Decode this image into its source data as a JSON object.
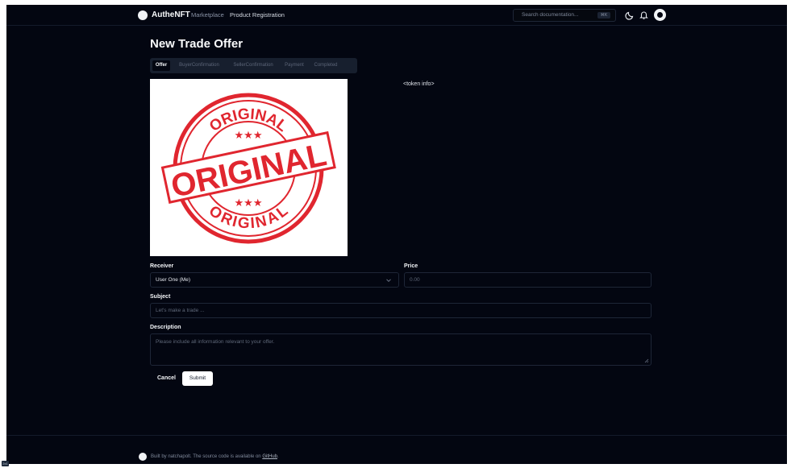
{
  "header": {
    "brand": "AutheNFT",
    "nav": [
      "Marketplace",
      "Product Registration"
    ],
    "search_placeholder": "Search documentation...",
    "search_shortcut": "⌘K",
    "icons": [
      "moon-icon",
      "bell-icon",
      "avatar"
    ]
  },
  "page": {
    "title": "New Trade Offer",
    "tabs": [
      "Offer",
      "BuyerConfirmation",
      "SellerConfirmation",
      "Payment",
      "Completed"
    ],
    "active_tab": "Offer",
    "token_info": "<token info>",
    "image_text": {
      "top": "ORIGINAL",
      "center": "ORIGINAL",
      "bottom": "ORIGINAL"
    }
  },
  "form": {
    "receiver_label": "Receiver",
    "receiver_value": "User One (Me)",
    "price_label": "Price",
    "price_placeholder": "0.00",
    "subject_label": "Subject",
    "subject_placeholder": "Let's make a trade ...",
    "description_label": "Description",
    "description_placeholder": "Please include all information relevant to your offer.",
    "cancel_label": "Cancel",
    "submit_label": "Submit"
  },
  "footer": {
    "text": "Built by natchapolt. The source code is available on ",
    "link": "GitHub",
    "end": "."
  },
  "badge": "2x1",
  "colors": {
    "background": "#030611",
    "accent": "#ffffff",
    "stamp": "#e0262f"
  }
}
